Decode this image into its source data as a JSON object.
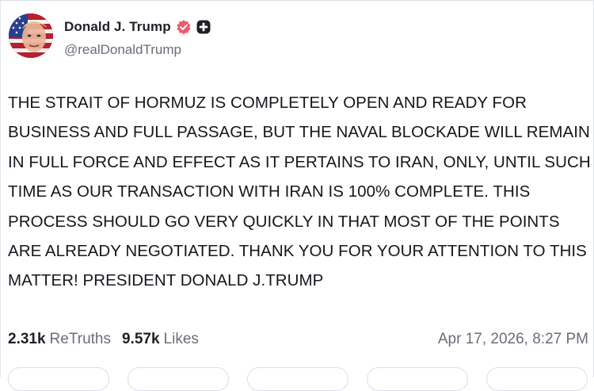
{
  "author": {
    "display_name": "Donald J. Trump",
    "handle": "@realDonaldTrump",
    "avatar_icon": "avatar-image",
    "verified_icon": "verified-badge-icon",
    "plus_icon": "plus-badge-icon"
  },
  "post": {
    "text": "THE STRAIT OF HORMUZ IS COMPLETELY OPEN AND READY FOR BUSINESS AND FULL PASSAGE, BUT THE NAVAL BLOCKADE WILL REMAIN IN FULL FORCE AND EFFECT AS IT PERTAINS TO IRAN, ONLY, UNTIL SUCH TIME AS OUR TRANSACTION WITH IRAN IS 100% COMPLETE. THIS PROCESS SHOULD GO VERY QUICKLY IN THAT MOST OF THE POINTS ARE ALREADY NEGOTIATED. THANK YOU FOR YOUR ATTENTION TO THIS MATTER! PRESIDENT DONALD J.TRUMP",
    "retruths_count": "2.31k",
    "retruths_label": "ReTruths",
    "likes_count": "9.57k",
    "likes_label": "Likes",
    "timestamp": "Apr 17, 2026, 8:27 PM"
  },
  "colors": {
    "verified_badge": "#f0596b",
    "plus_badge": "#1f1f27",
    "text_primary": "#16161d",
    "text_secondary": "#6b6d7a",
    "border": "#dcdee8"
  }
}
